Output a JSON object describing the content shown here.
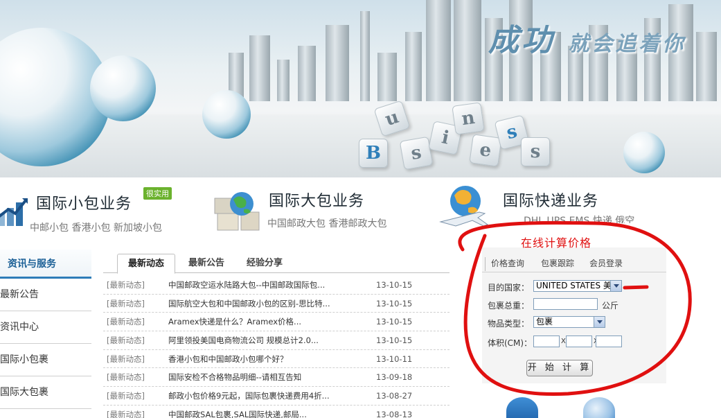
{
  "banner": {
    "slogan_partial": "成功",
    "slogan_small": "就会追着你",
    "cube_letters": [
      "B",
      "u",
      "s",
      "i",
      "n",
      "e",
      "s",
      "s"
    ]
  },
  "services": [
    {
      "title": "国际小包业务",
      "badge": "很实用",
      "subtitle": "中邮小包  香港小包    新加坡小包"
    },
    {
      "title": "国际大包业务",
      "subtitle": "中国邮政大包  香港邮政大包"
    },
    {
      "title": "国际快递业务",
      "subtitle": "DHL  UPS  EMS  快递  俄空"
    }
  ],
  "left_nav": {
    "header": "资讯与服务",
    "items": [
      "最新公告",
      "资讯中心",
      "国际小包裹",
      "国际大包裹"
    ]
  },
  "news": {
    "tabs": [
      "最新动态",
      "最新公告",
      "经验分享"
    ],
    "active_tab": "最新动态",
    "rows": [
      {
        "cat": "[最新动态]",
        "title": "中国邮政空运水陆路大包--中国邮政国际包...",
        "date": "13-10-15"
      },
      {
        "cat": "[最新动态]",
        "title": "国际航空大包和中国邮政小包的区别-思比特...",
        "date": "13-10-15"
      },
      {
        "cat": "[最新动态]",
        "title": "Aramex快递是什么？Aramex价格...",
        "date": "13-10-15"
      },
      {
        "cat": "[最新动态]",
        "title": "阿里领投美国电商物流公司 规模总计2.0...",
        "date": "13-10-15"
      },
      {
        "cat": "[最新动态]",
        "title": "香港小包和中国邮政小包哪个好？",
        "date": "13-10-11"
      },
      {
        "cat": "[最新动态]",
        "title": "国际安检不合格物品明细--请相互告知",
        "date": "13-09-18"
      },
      {
        "cat": "[最新动态]",
        "title": "邮政小包价格9元起，国际包裹快递费用4折...",
        "date": "13-08-27"
      },
      {
        "cat": "[最新动态]",
        "title": "中国邮政SAL包裹,SAL国际快递,邮局...",
        "date": "13-08-13"
      }
    ]
  },
  "calculator": {
    "annotation": "在线计算价格",
    "tabs": [
      "价格查询",
      "包裹跟踪",
      "会员登录"
    ],
    "country_label": "目的国家：",
    "country_value": "UNITED STATES 美",
    "weight_label": "包裹总重：",
    "weight_unit": "公斤",
    "type_label": "物品类型：",
    "type_value": "包裹",
    "volume_label": "体积(CM)：",
    "x": "X",
    "button": "开 始 计 算"
  },
  "colors": {
    "nav_blue": "#1a5f96",
    "annotation_red": "#e01010",
    "badge_green": "#6bb22d"
  }
}
